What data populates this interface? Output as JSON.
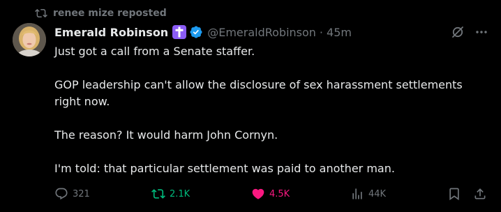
{
  "repost_banner": {
    "text": "renee mize reposted",
    "icon": "repost-icon"
  },
  "author": {
    "display_name": "Emerald Robinson",
    "badge_emoji": "latin-cross",
    "verified": true,
    "handle": "@EmeraldRobinson",
    "separator": "·",
    "time": "45m"
  },
  "tweet": {
    "paragraphs": [
      "Just got a call from a Senate staffer.",
      "GOP leadership can't allow the disclosure of sex harassment settlements right now.",
      "The reason? It would harm John Cornyn.",
      "I'm told: that particular settlement was paid to another man."
    ]
  },
  "actions": {
    "replies": "321",
    "reposts": "2.1K",
    "likes": "4.5K",
    "views": "44K"
  },
  "colors": {
    "background": "#000000",
    "text": "#e7e9ea",
    "muted": "#71767b",
    "verified_blue": "#1d9bf0",
    "badge_purple": "#8b5cf6",
    "repost_green": "#00ba7c",
    "like_pink": "#f91880"
  }
}
